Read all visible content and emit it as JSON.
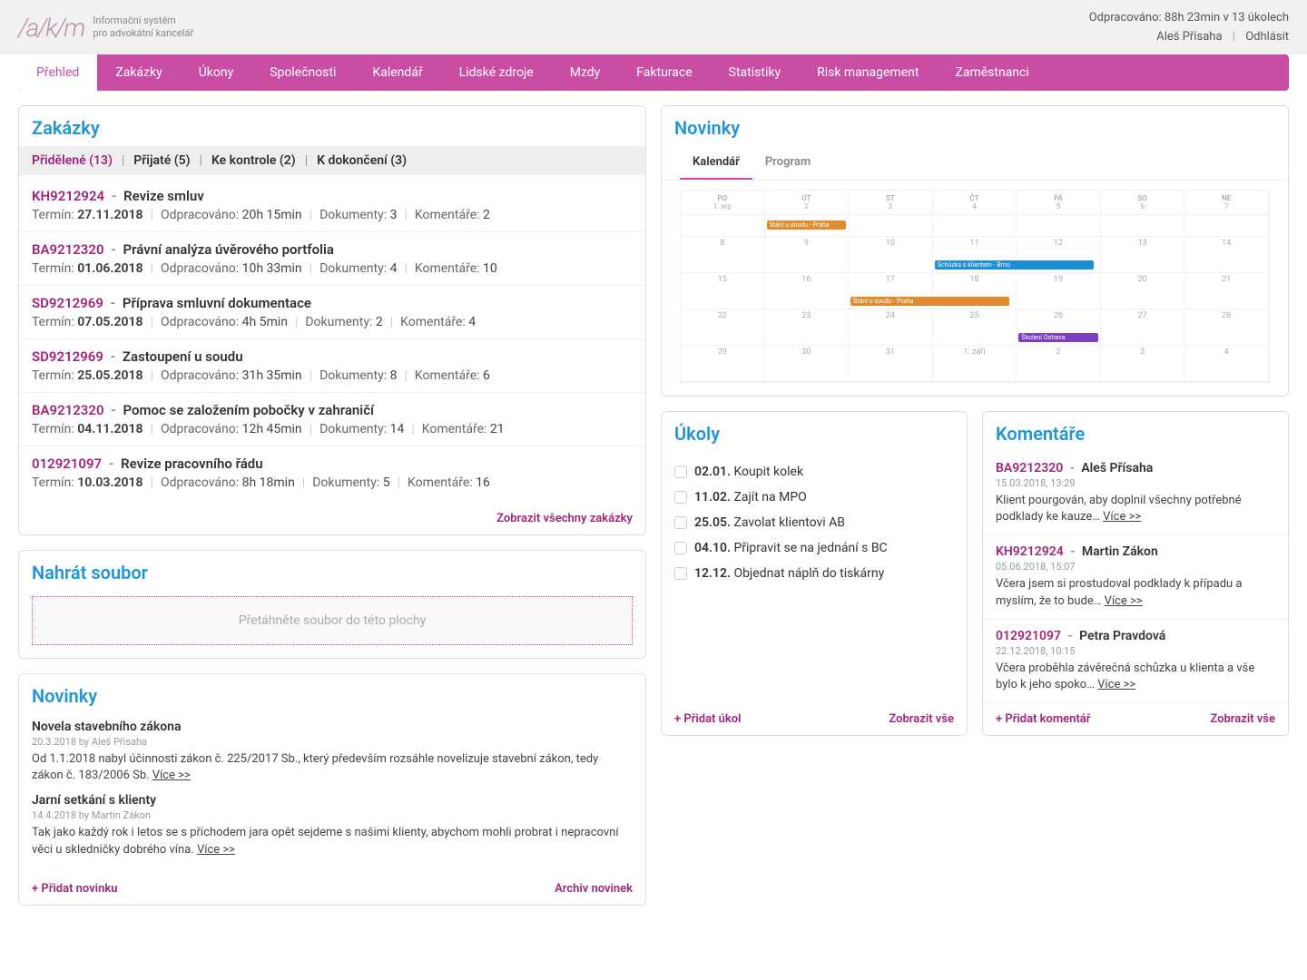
{
  "header": {
    "logo": "/a/k/m",
    "subtitle1": "Informační systém",
    "subtitle2": "pro advokátní kancelář",
    "worked": "Odpracováno: 88h 23min v 13 úkolech",
    "user": "Aleš Přísaha",
    "logout": "Odhlásit"
  },
  "nav": [
    "Přehled",
    "Zakázky",
    "Úkony",
    "Společnosti",
    "Kalendář",
    "Lidské zdroje",
    "Mzdy",
    "Fakturace",
    "Statistiky",
    "Risk management",
    "Zaměstnanci"
  ],
  "zakazky": {
    "title": "Zakázky",
    "tabs": [
      "Přidělené (13)",
      "Přijaté (5)",
      "Ke kontrole (2)",
      "K dokončení (3)"
    ],
    "items": [
      {
        "code": "KH9212924",
        "name": "Revize smluv",
        "deadline_lbl": "Termín:",
        "deadline": "27.11.2018",
        "worked_lbl": "Odpracováno:",
        "worked": "20h 15min",
        "docs_lbl": "Dokumenty:",
        "docs": "3",
        "comm_lbl": "Komentáře:",
        "comm": "2"
      },
      {
        "code": "BA9212320",
        "name": "Právní analýza úvěrového portfolia",
        "deadline_lbl": "Termín:",
        "deadline": "01.06.2018",
        "worked_lbl": "Odpracováno:",
        "worked": "10h 33min",
        "docs_lbl": "Dokumenty:",
        "docs": "4",
        "comm_lbl": "Komentáře:",
        "comm": "10"
      },
      {
        "code": "SD9212969",
        "name": "Příprava smluvní dokumentace",
        "deadline_lbl": "Termín:",
        "deadline": "07.05.2018",
        "worked_lbl": "Odpracováno:",
        "worked": "4h 5min",
        "docs_lbl": "Dokumenty:",
        "docs": "2",
        "comm_lbl": "Komentáře:",
        "comm": "4"
      },
      {
        "code": "SD9212969",
        "name": "Zastoupení u soudu",
        "deadline_lbl": "Termín:",
        "deadline": "25.05.2018",
        "worked_lbl": "Odpracováno:",
        "worked": "31h 35min",
        "docs_lbl": "Dokumenty:",
        "docs": "8",
        "comm_lbl": "Komentáře:",
        "comm": "6"
      },
      {
        "code": "BA9212320",
        "name": "Pomoc se založením pobočky v zahraničí",
        "deadline_lbl": "Termín:",
        "deadline": "04.11.2018",
        "worked_lbl": "Odpracováno:",
        "worked": "12h 45min",
        "docs_lbl": "Dokumenty:",
        "docs": "14",
        "comm_lbl": "Komentáře:",
        "comm": "21"
      },
      {
        "code": "012921097",
        "name": "Revize pracovního řádu",
        "deadline_lbl": "Termín:",
        "deadline": "10.03.2018",
        "worked_lbl": "Odpracováno:",
        "worked": "8h 18min",
        "docs_lbl": "Dokumenty:",
        "docs": "5",
        "comm_lbl": "Komentáře:",
        "comm": "16"
      }
    ],
    "show_all": "Zobrazit všechny zakázky"
  },
  "novinky_panel": {
    "title": "Novinky",
    "tabs": [
      "Kalendář",
      "Program"
    ],
    "weekdays": [
      {
        "d": "PO",
        "n": "1. srp"
      },
      {
        "d": "ÚT",
        "n": "2"
      },
      {
        "d": "ST",
        "n": "3"
      },
      {
        "d": "ČT",
        "n": "4"
      },
      {
        "d": "PÁ",
        "n": "5"
      },
      {
        "d": "SO",
        "n": "6"
      },
      {
        "d": "NE",
        "n": "7"
      }
    ],
    "weeks": [
      [
        "8",
        "9",
        "10",
        "11",
        "12",
        "13",
        "14"
      ],
      [
        "15",
        "16",
        "17",
        "18",
        "19",
        "20",
        "21"
      ],
      [
        "22",
        "23",
        "24",
        "25",
        "26",
        "27",
        "28"
      ],
      [
        "29",
        "30",
        "31",
        "1. září",
        "2",
        "3",
        "4"
      ]
    ],
    "events": {
      "w0_c1": {
        "text": "Stání u soudu - Praha",
        "cls": "ev-orange",
        "span": 1
      },
      "w1_c3": {
        "text": "Schůzka s klientem - Brno",
        "cls": "ev-blue",
        "span": 2
      },
      "w2_c2": {
        "text": "Stání u soudu - Praha",
        "cls": "ev-orange",
        "span": 2
      },
      "w3_c4": {
        "text": "Školení Ostrava",
        "cls": "ev-purple",
        "span": 1
      }
    }
  },
  "upload": {
    "title": "Nahrát soubor",
    "placeholder": "Přetáhněte soubor do této plochy"
  },
  "novinky_list": {
    "title": "Novinky",
    "items": [
      {
        "title": "Novela stavebního zákona",
        "date": "20.3.2018 by Aleš Přísaha",
        "body": "Od 1.1.2018 nabyl účinnosti zákon č. 225/2017 Sb., který především rozsáhle novelizuje stavební zákon, tedy zákon č. 183/2006 Sb.",
        "more": "Více >>"
      },
      {
        "title": "Jarní setkání s klienty",
        "date": "14.4.2018 by Martin Zákon",
        "body": "Tak jako každý rok i letos se s příchodem jara opět sejdeme s našimi klienty, abychom mohli probrat i nepracovní věci u skledničky dobrého vína.",
        "more": "Více >>"
      }
    ],
    "add": "+ Přidat novinku",
    "archive": "Archiv novinek"
  },
  "ukoly": {
    "title": "Úkoly",
    "items": [
      {
        "date": "02.01.",
        "text": "Koupit kolek"
      },
      {
        "date": "11.02.",
        "text": "Zajít na MPO"
      },
      {
        "date": "25.05.",
        "text": "Zavolat klientovi AB"
      },
      {
        "date": "04.10.",
        "text": "Připravit se na jednání s BC"
      },
      {
        "date": "12.12.",
        "text": "Objednat náplň do tiskárny"
      }
    ],
    "add": "+ Přidat úkol",
    "show_all": "Zobrazit vše"
  },
  "komentare": {
    "title": "Komentáře",
    "items": [
      {
        "code": "BA9212320",
        "author": "Aleš Přísaha",
        "date": "15.03.2018, 13:29",
        "body": "Klient pourgován, aby doplnil všechny potřebné podklady ke kauze…",
        "more": "Více >>"
      },
      {
        "code": "KH9212924",
        "author": "Martin Zákon",
        "date": "05.06.2018, 15:07",
        "body": "Včera jsem si prostudoval podklady k případu a myslím, že to bude…",
        "more": "Více >>"
      },
      {
        "code": "012921097",
        "author": "Petra Pravdová",
        "date": "22.12.2018, 10:15",
        "body": "Včera proběhla závěrečná schůzka u klienta a vše bylo k jeho spoko…",
        "more": "Více >>"
      }
    ],
    "add": "+ Přidat komentář",
    "show_all": "Zobrazit vše"
  }
}
